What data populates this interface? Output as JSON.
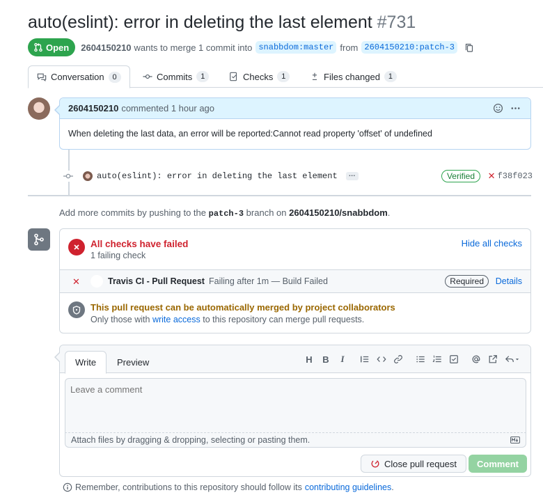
{
  "pr": {
    "title": "auto(eslint): error in deleting the last element",
    "number": "#731",
    "state": "Open",
    "author": "2604150210",
    "merge_text": "wants to merge 1 commit into",
    "base_branch": "snabbdom:master",
    "from_text": "from",
    "head_branch": "2604150210:patch-3"
  },
  "tabs": [
    {
      "label": "Conversation",
      "count": "0"
    },
    {
      "label": "Commits",
      "count": "1"
    },
    {
      "label": "Checks",
      "count": "1"
    },
    {
      "label": "Files changed",
      "count": "1"
    }
  ],
  "comment": {
    "author": "2604150210",
    "action": "commented 1 hour ago",
    "body": "When deleting the last data, an error will be reported:Cannot read property 'offset' of undefined"
  },
  "commit": {
    "message": "auto(eslint): error in deleting the last element",
    "ellipsis": "…",
    "verified": "Verified",
    "sha": "f38f023"
  },
  "add_commits": {
    "prefix": "Add more commits by pushing to the",
    "branch": "patch-3",
    "middle": "branch on",
    "repo": "2604150210/snabbdom",
    "suffix": "."
  },
  "checks": {
    "title": "All checks have failed",
    "subtitle": "1 failing check",
    "hide_link": "Hide all checks",
    "item_name": "Travis CI - Pull Request",
    "item_status": "Failing after 1m — Build Failed",
    "required": "Required",
    "details": "Details"
  },
  "merge": {
    "title": "This pull request can be automatically merged by project collaborators",
    "sub_prefix": "Only those with",
    "sub_link": "write access",
    "sub_suffix": "to this repository can merge pull requests."
  },
  "editor": {
    "tab_write": "Write",
    "tab_preview": "Preview",
    "placeholder": "Leave a comment",
    "attach_text": "Attach files by dragging & dropping, selecting or pasting them.",
    "close_button": "Close pull request",
    "comment_button": "Comment"
  },
  "footer": {
    "prefix": "Remember, contributions to this repository should follow its",
    "link": "contributing guidelines",
    "suffix": "."
  },
  "colors": {
    "open_green": "#2da44e",
    "fail_red": "#cf222e",
    "link_blue": "#0969da",
    "warn_yellow": "#9a6700"
  }
}
